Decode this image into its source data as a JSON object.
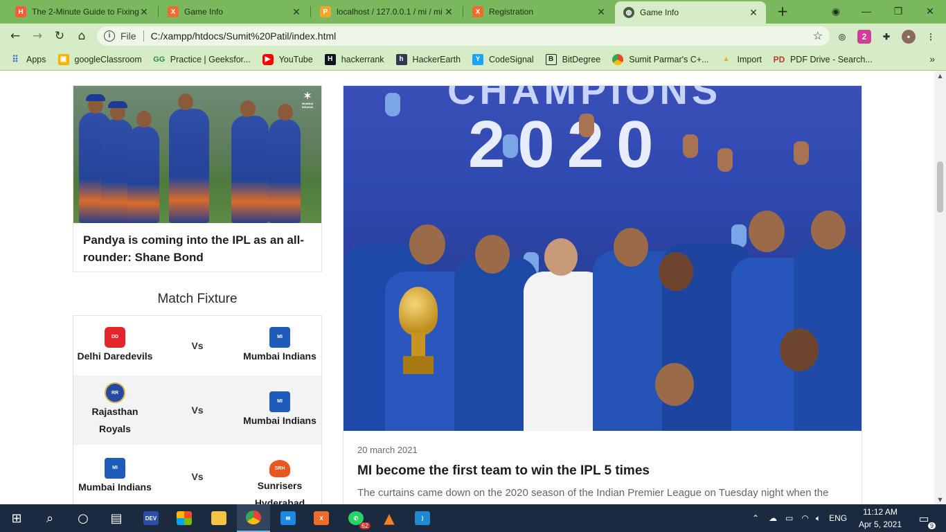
{
  "browser": {
    "tabs": [
      {
        "title": "The 2-Minute Guide to Fixing",
        "favicon": "hostinger-icon",
        "active": false
      },
      {
        "title": "Game Info",
        "favicon": "xampp-icon",
        "active": false
      },
      {
        "title": "localhost / 127.0.0.1 / mi / mi",
        "favicon": "phpmyadmin-icon",
        "active": false
      },
      {
        "title": "Registration",
        "favicon": "xampp-icon",
        "active": false
      },
      {
        "title": "Game Info",
        "favicon": "globe-icon",
        "active": true
      }
    ],
    "address": {
      "scheme_label": "File",
      "url": "C:/xampp/htdocs/Sumit%20Patil/index.html"
    },
    "bookmarks": [
      {
        "label": "Apps",
        "icon": "apps-grid-icon"
      },
      {
        "label": "googleClassroom",
        "icon": "classroom-icon"
      },
      {
        "label": "Practice | Geeksfor...",
        "icon": "geeksforgeeks-icon"
      },
      {
        "label": "YouTube",
        "icon": "youtube-icon"
      },
      {
        "label": "hackerrank",
        "icon": "hackerrank-icon"
      },
      {
        "label": "HackerEarth",
        "icon": "hackerearth-icon"
      },
      {
        "label": "CodeSignal",
        "icon": "codesignal-icon"
      },
      {
        "label": "BitDegree",
        "icon": "bitdegree-icon"
      },
      {
        "label": "Sumit Parmar's C+...",
        "icon": "chrome-icon"
      },
      {
        "label": "Import",
        "icon": "phpmyadmin-icon"
      },
      {
        "label": "PDF Drive - Search...",
        "icon": "pdfdrive-icon"
      }
    ],
    "colors": {
      "frame": "#79b85d",
      "toolbar": "#d5ecc6"
    }
  },
  "page": {
    "side_news": {
      "title": "Pandya is coming into the IPL as an all-rounder: Shane Bond",
      "watermark": "MUMBAI INDIANS"
    },
    "fixture": {
      "heading": "Match Fixture",
      "vs_label": "Vs",
      "matches": [
        {
          "home": "Delhi Daredevils",
          "away": "Mumbai Indians"
        },
        {
          "home": "Rajasthan Royals",
          "away": "Mumbai Indians"
        },
        {
          "home": "Mumbai Indians",
          "away": "Sunrisers Hyderabad"
        }
      ]
    },
    "main_article": {
      "banner_text": "2020",
      "banner_top": "CHAMPIONS",
      "date": "20 march 2021",
      "title": "MI become the first team to win the IPL 5 times",
      "excerpt": "The curtains came down on the 2020 season of the Indian Premier League on Tuesday night when the"
    }
  },
  "taskbar": {
    "apps": [
      "windows-start-icon",
      "search-icon",
      "cortana-icon",
      "task-view-icon",
      "dev-icon",
      "store-icon",
      "file-explorer-icon",
      "chrome-icon",
      "mail-icon",
      "xampp-icon",
      "whatsapp-icon",
      "vlc-icon",
      "vscode-icon"
    ],
    "whatsapp_badge": "62",
    "language": "ENG",
    "time": "11:12 AM",
    "date": "Apr 5, 2021",
    "notification_count": "9"
  }
}
